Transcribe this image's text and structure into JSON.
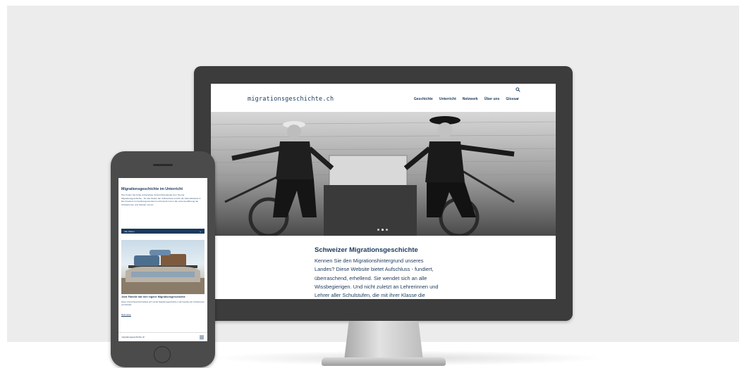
{
  "desktop": {
    "logo": "migrationsgeschichte.ch",
    "nav": [
      "Geschichte",
      "Unterricht",
      "Netzwerk",
      "Über uns",
      "Glossar"
    ],
    "heading": "Schweizer Migrationsgeschichte",
    "intro_lines": [
      "Kennen Sie den Migrationshintergrund unseres",
      "Landes? Diese Website bietet Aufschluss - fundiert,",
      "überraschend, erhellend. Sie wendet sich an alle",
      "Wissbegierigen. Und nicht zuletzt an Lehrerinnen und",
      "Lehrer aller Schulstufen, die mit ihrer Klasse die"
    ],
    "slider_active_dot": 2,
    "slider_dot_count": 3
  },
  "mobile": {
    "title": "Migrationsgeschichte im Unterricht",
    "intro": "Hier finden Sie fertig vorbereitete Unterrichtsmaterial zum Thema Migrationsgeschichte - für alle Stufen der Volksschule und für die Sekundarstufe II. Die Dossiers ist handlungsorientiert und bezieht immer die Lebenserfahrung der Schülerinnen und Schüler mit ein.",
    "filter_label": "Alle Stufen",
    "card_title": "Jede Familie hat ihre eigene Migrationsgeschichte",
    "card_text": "Diese Unterrichtseinheit befasst sich mit der Migrationsgeschichte in der Familien der Schülerinnen und Schüler.",
    "card_link": "Mehr lesen",
    "footer_logo": "migrationsgeschichte.ch"
  },
  "icons": [
    "search-icon",
    "chevron-down-icon",
    "hamburger-menu-icon"
  ],
  "colors": {
    "brand_navy": "#1b3a5c",
    "monitor_bezel": "#3c3c3c",
    "phone_body": "#4b4b4b",
    "backdrop": "#ececec"
  }
}
